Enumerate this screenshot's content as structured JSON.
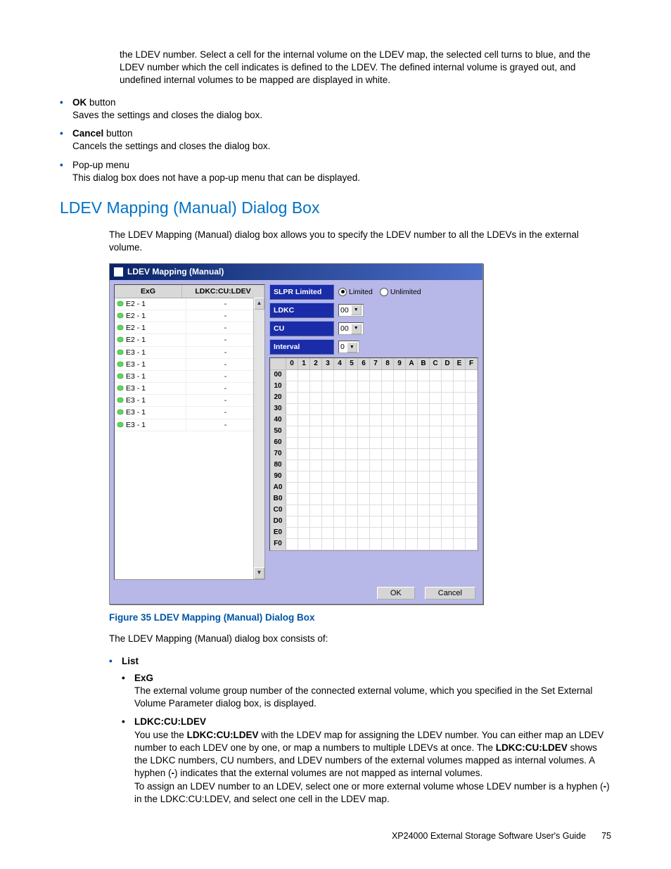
{
  "intro_paragraph": "the LDEV number. Select a cell for the internal volume on the LDEV map, the selected cell turns to blue, and the LDEV number which the cell indicates is defined to the LDEV. The defined internal volume is grayed out, and undefined internal volumes to be mapped are displayed in white.",
  "top_bullets": [
    {
      "term": "OK",
      "suffix": " button",
      "desc": "Saves the settings and closes the dialog box."
    },
    {
      "term": "Cancel",
      "suffix": " button",
      "desc": "Cancels the settings and closes the dialog box."
    },
    {
      "term": "Pop-up menu",
      "suffix": "",
      "desc": "This dialog box does not have a pop-up menu that can be displayed."
    }
  ],
  "section_title": "LDEV Mapping (Manual) Dialog Box",
  "section_intro": "The LDEV Mapping (Manual) dialog box allows you to specify the LDEV number to all the LDEVs in the external volume.",
  "dialog": {
    "title": "LDEV Mapping (Manual)",
    "list_headers": {
      "c1": "ExG",
      "c2": "LDKC:CU:LDEV"
    },
    "list_rows": [
      {
        "exg": "E2 - 1",
        "val": "-"
      },
      {
        "exg": "E2 - 1",
        "val": "-"
      },
      {
        "exg": "E2 - 1",
        "val": "-"
      },
      {
        "exg": "E2 - 1",
        "val": "-"
      },
      {
        "exg": "E3 - 1",
        "val": "-"
      },
      {
        "exg": "E3 - 1",
        "val": "-"
      },
      {
        "exg": "E3 - 1",
        "val": "-"
      },
      {
        "exg": "E3 - 1",
        "val": "-"
      },
      {
        "exg": "E3 - 1",
        "val": "-"
      },
      {
        "exg": "E3 - 1",
        "val": "-"
      },
      {
        "exg": "E3 - 1",
        "val": "-"
      }
    ],
    "params": {
      "slpr_label": "SLPR Limited",
      "slpr_opt1": "Limited",
      "slpr_opt2": "Unlimited",
      "ldkc_label": "LDKC",
      "ldkc_val": "00",
      "cu_label": "CU",
      "cu_val": "00",
      "interval_label": "Interval",
      "interval_val": "0"
    },
    "grid_cols": [
      "0",
      "1",
      "2",
      "3",
      "4",
      "5",
      "6",
      "7",
      "8",
      "9",
      "A",
      "B",
      "C",
      "D",
      "E",
      "F"
    ],
    "grid_rows": [
      "00",
      "10",
      "20",
      "30",
      "40",
      "50",
      "60",
      "70",
      "80",
      "90",
      "A0",
      "B0",
      "C0",
      "D0",
      "E0",
      "F0"
    ],
    "ok_label": "OK",
    "cancel_label": "Cancel"
  },
  "figure_caption": "Figure 35 LDEV Mapping (Manual) Dialog Box",
  "after_fig": "The LDEV Mapping (Manual) dialog box consists of:",
  "list_label": "List",
  "sub_exg_label": "ExG",
  "sub_exg_desc": "The external volume group number of the connected external volume, which you specified in the Set External Volume Parameter dialog box, is displayed.",
  "sub_ldev_label": "LDKC:CU:LDEV",
  "sub_ldev_p1_pre": "You use the ",
  "sub_ldev_p1_bold": "LDKC:CU:LDEV",
  "sub_ldev_p1_post": " with the LDEV map for assigning the LDEV number. You can either map an LDEV number to each LDEV one by one, or map a numbers to multiple LDEVs at once. The ",
  "sub_ldev_p1_bold2": "LDKC:CU:LDEV",
  "sub_ldev_p1_post2": " shows the LDKC numbers, CU numbers, and LDEV numbers of the external volumes mapped as internal volumes. A hyphen (",
  "sub_ldev_hyphen": "-",
  "sub_ldev_p1_post3": ") indicates that the external volumes are not mapped as internal volumes.",
  "sub_ldev_p2_pre": "To assign an LDEV number to an LDEV, select one or more external volume whose LDEV number is a hyphen (",
  "sub_ldev_p2_post": ") in the LDKC:CU:LDEV, and select one cell in the LDEV map.",
  "footer_text": "XP24000 External Storage Software User's Guide",
  "page_number": "75"
}
